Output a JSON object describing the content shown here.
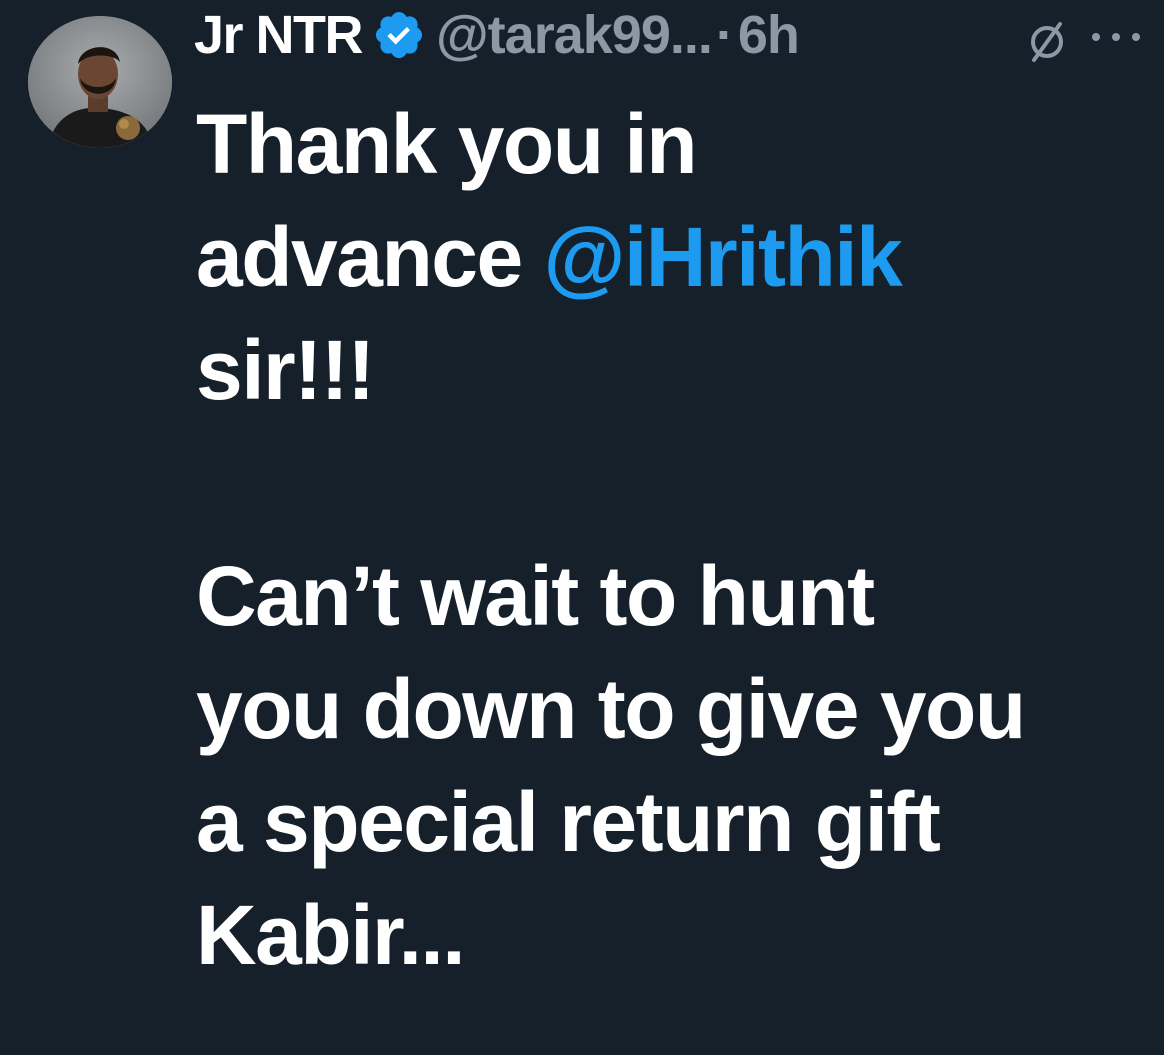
{
  "author": {
    "display_name": "Jr NTR",
    "handle": "@tarak99...",
    "separator": "·",
    "time": "6h",
    "verified": true
  },
  "icons": {
    "avatar": "profile-photo",
    "verified": "verified-badge-icon",
    "grok": "slash-circle-icon",
    "more": "more-options-icon"
  },
  "tweet": {
    "line1": "Thank you in",
    "line2_text": "advance ",
    "line2_mention": "@iHrithik",
    "line3": "sir!!!",
    "line4": "Can’t wait to hunt",
    "line5": "you down to give you",
    "line6": "a special return gift",
    "line7": "Kabir..."
  },
  "colors": {
    "background": "#15202b",
    "text": "#ffffff",
    "secondary": "#8b98a5",
    "accent": "#1d9bf0"
  }
}
